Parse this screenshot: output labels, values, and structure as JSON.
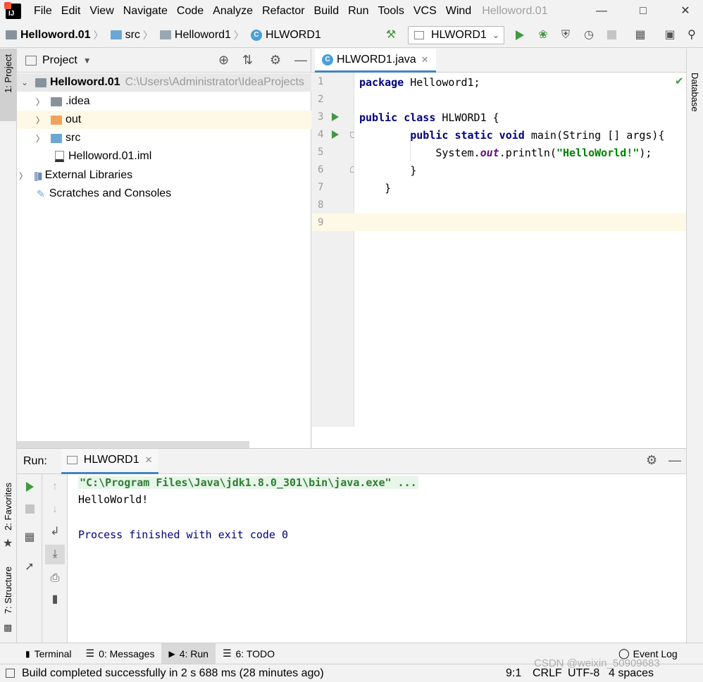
{
  "menu": {
    "items": [
      "File",
      "Edit",
      "View",
      "Navigate",
      "Code",
      "Analyze",
      "Refactor",
      "Build",
      "Run",
      "Tools",
      "VCS",
      "Wind"
    ],
    "window_title": "Helloword.01"
  },
  "nav": {
    "breadcrumbs": [
      "Helloword.01",
      "src",
      "Helloword1",
      "HLWORD1"
    ],
    "run_config": "HLWORD1"
  },
  "left_stripe": {
    "project_tab": "1: Project",
    "favorites_tab": "2: Favorites",
    "structure_tab": "7: Structure"
  },
  "right_stripe": {
    "database_tab": "Database"
  },
  "project": {
    "header": "Project",
    "root_name": "Helloword.01",
    "root_path": "C:\\Users\\Administrator\\IdeaProjects",
    "items": [
      ".idea",
      "out",
      "src",
      "Helloword.01.iml"
    ],
    "external_libraries": "External Libraries",
    "scratches": "Scratches and Consoles"
  },
  "editor": {
    "tab_label": "HLWORD1.java",
    "line_numbers": [
      "1",
      "2",
      "3",
      "4",
      "5",
      "6",
      "7",
      "8",
      "9"
    ],
    "code": {
      "l1_kw": "package",
      "l1_rest": " Helloword1;",
      "l3_kw": "public class",
      "l3_rest": " HLWORD1 {",
      "l4_indent": "        ",
      "l4_kw": "public static void",
      "l4_rest": " main(String [] args){",
      "l5_a": "            System.",
      "l5_out": "out",
      "l5_b": ".println(",
      "l5_str": "\"HelloWorld!\"",
      "l5_c": ");",
      "l6": "        }",
      "l7": "    }"
    }
  },
  "run": {
    "label": "Run:",
    "tab": "HLWORD1",
    "console": {
      "cmd": "\"C:\\Program Files\\Java\\jdk1.8.0_301\\bin\\java.exe\" ...",
      "output": "HelloWorld!",
      "exit": "Process finished with exit code 0"
    }
  },
  "bottom_tools": {
    "terminal": "Terminal",
    "messages": "0: Messages",
    "run": "4: Run",
    "todo": "6: TODO",
    "event_log": "Event Log"
  },
  "status": {
    "message": "Build completed successfully in 2 s 688 ms (28 minutes ago)",
    "position": "9:1",
    "line_sep": "CRLF",
    "encoding": "UTF-8",
    "indent": "4 spaces",
    "watermark": "CSDN @weixin_50909683"
  },
  "colors": {
    "accent": "#4083c9",
    "run_green": "#3f9b3f",
    "keyword": "#000080",
    "string": "#008000",
    "console_cmd_bg": "#e8f5e9",
    "current_line": "#fdf9e6"
  }
}
